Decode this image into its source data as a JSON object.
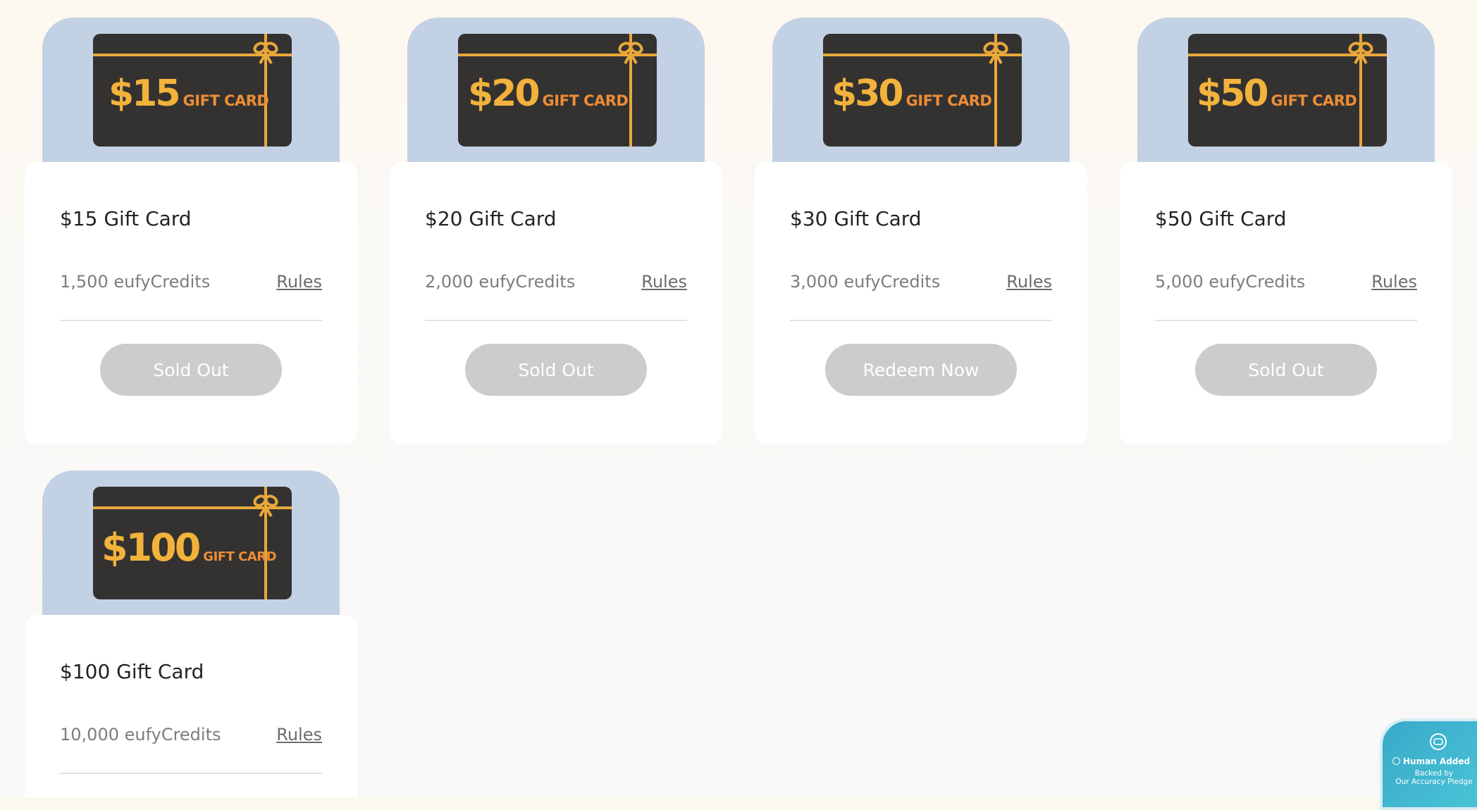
{
  "cards": [
    {
      "image": {
        "amount": "$15",
        "label": "GIFT CARD"
      },
      "title": "$15 Gift Card",
      "credits": "1,500 eufyCredits",
      "rules": "Rules",
      "button": "Sold Out"
    },
    {
      "image": {
        "amount": "$20",
        "label": "GIFT CARD"
      },
      "title": "$20 Gift Card",
      "credits": "2,000 eufyCredits",
      "rules": "Rules",
      "button": "Sold Out"
    },
    {
      "image": {
        "amount": "$30",
        "label": "GIFT CARD"
      },
      "title": "$30 Gift Card",
      "credits": "3,000 eufyCredits",
      "rules": "Rules",
      "button": "Redeem Now"
    },
    {
      "image": {
        "amount": "$50",
        "label": "GIFT CARD"
      },
      "title": "$50 Gift Card",
      "credits": "5,000 eufyCredits",
      "rules": "Rules",
      "button": "Sold Out"
    },
    {
      "image": {
        "amount": "$100",
        "label": "GIFT CARD"
      },
      "title": "$100 Gift Card",
      "credits": "10,000 eufyCredits",
      "rules": "Rules",
      "button": ""
    }
  ],
  "badge": {
    "icon": "chat-bubble-icon",
    "title": "Human Added",
    "line1": "Backed by",
    "line2": "Our Accuracy Pledge"
  },
  "colors": {
    "card_header_bg": "#c3d1e4",
    "gift_card_bg": "#333231",
    "gift_amount": "#f2b23b",
    "gift_label": "#ed8d35",
    "button_disabled": "#cccccc",
    "badge_bg": "#39a9c9"
  }
}
